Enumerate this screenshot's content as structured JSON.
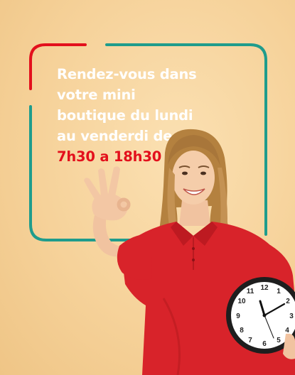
{
  "banner": {
    "headline_lines": [
      "Rendez-vous dans",
      "votre mini",
      "boutique du lundi",
      "au venderdi de"
    ],
    "hours": "7h30 a 18h30"
  },
  "clock": {
    "numerals": [
      "12",
      "1",
      "2",
      "3",
      "4",
      "5",
      "6",
      "7",
      "8",
      "9",
      "10",
      "11"
    ]
  },
  "colors": {
    "background": "#f6d29a",
    "frame_red": "#e3101c",
    "frame_teal": "#1f9c8c",
    "headline_text": "#ffffff",
    "hours_text": "#e3101c",
    "shirt_red": "#d8232a"
  },
  "icons": [
    "ok-hand-gesture",
    "wall-clock"
  ]
}
